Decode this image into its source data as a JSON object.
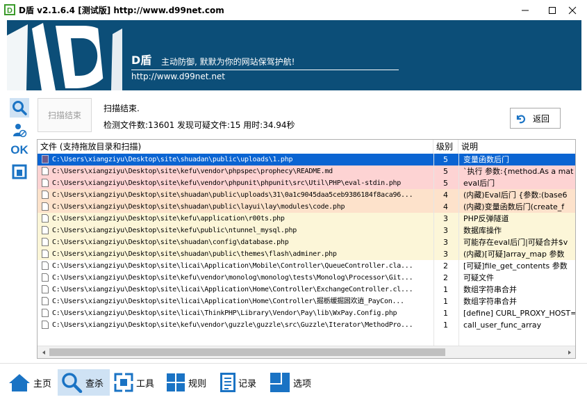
{
  "window": {
    "title": "D盾 v2.1.6.4 [测试版] http://www.d99net.com",
    "icon": "d-shield-app-icon",
    "controls": [
      "minimize",
      "maximize",
      "close"
    ]
  },
  "banner": {
    "logo_letter": "D",
    "brand": "D盾",
    "slogan": "主动防御, 默默为你的网站保驾护航!",
    "url": "http://www.d99net.net"
  },
  "sidebar_icons": [
    "search-icon",
    "user-shield-icon",
    "ok-icon",
    "window-icon"
  ],
  "sidebar_ok_text": "OK",
  "scan": {
    "button_label": "扫描结束",
    "status": "扫描结束.",
    "summary": "检测文件数:13601 发现可疑文件:15 用时:34.94秒",
    "back_label": "返回"
  },
  "table": {
    "headers": {
      "file": "文件 (支持拖放目录和扫描)",
      "level": "级别",
      "desc": "说明"
    },
    "rows": [
      {
        "file": "C:\\Users\\xiangziyu\\Desktop\\site\\shuadan\\public\\uploads\\1.php",
        "level": "5",
        "desc": "变量函数后门",
        "style": "selected"
      },
      {
        "file": "C:\\Users\\xiangziyu\\Desktop\\site\\kefu\\vendor\\phpspec\\prophecy\\README.md",
        "level": "5",
        "desc": "`执行 参数:{method.As a mat",
        "style": "red"
      },
      {
        "file": "C:\\Users\\xiangziyu\\Desktop\\site\\kefu\\vendor\\phpunit\\phpunit\\src\\Util\\PHP\\eval-stdin.php",
        "level": "5",
        "desc": "eval后门",
        "style": "red"
      },
      {
        "file": "C:\\Users\\xiangziyu\\Desktop\\site\\shuadan\\public\\uploads\\31\\0a1c9045daa5ceb9386184f8aca96...",
        "level": "4",
        "desc": "(内藏)Eval后门 {参数:(base6",
        "style": "orange"
      },
      {
        "file": "C:\\Users\\xiangziyu\\Desktop\\site\\shuadan\\public\\layui\\lay\\modules\\code.php",
        "level": "4",
        "desc": "(内藏)变量函数后门(create_f",
        "style": "orange"
      },
      {
        "file": "C:\\Users\\xiangziyu\\Desktop\\site\\kefu\\application\\r00ts.php",
        "level": "3",
        "desc": "PHP反弹隧道",
        "style": "yellow"
      },
      {
        "file": "C:\\Users\\xiangziyu\\Desktop\\site\\kefu\\public\\ntunnel_mysql.php",
        "level": "3",
        "desc": "数据库操作",
        "style": "yellow"
      },
      {
        "file": "C:\\Users\\xiangziyu\\Desktop\\site\\shuadan\\config\\database.php",
        "level": "3",
        "desc": "可能存在eval后门|可疑合并$v",
        "style": "yellow"
      },
      {
        "file": "C:\\Users\\xiangziyu\\Desktop\\site\\shuadan\\public\\themes\\flash\\adminer.php",
        "level": "3",
        "desc": "(内藏)[可疑]array_map 参数",
        "style": "yellow"
      },
      {
        "file": "C:\\Users\\xiangziyu\\Desktop\\site\\licai\\Application\\Mobile\\Controller\\QueueController.cla...",
        "level": "2",
        "desc": "[可疑]file_get_contents 参数",
        "style": "white"
      },
      {
        "file": "C:\\Users\\xiangziyu\\Desktop\\site\\kefu\\vendor\\monolog\\monolog\\tests\\Monolog\\Processor\\Git...",
        "level": "2",
        "desc": "可疑文件",
        "style": "white"
      },
      {
        "file": "C:\\Users\\xiangziyu\\Desktop\\site\\licai\\Application\\Home\\Controller\\ExchangeController.cl...",
        "level": "1",
        "desc": "数组字符串合并",
        "style": "white"
      },
      {
        "file": "C:\\Users\\xiangziyu\\Desktop\\site\\licai\\Application\\Home\\Controller\\掘栃缓掘囦欢逍_PayCon...",
        "level": "1",
        "desc": "数组字符串合并",
        "style": "white"
      },
      {
        "file": "C:\\Users\\xiangziyu\\Desktop\\site\\licai\\ThinkPHP\\Library\\Vendor\\Pay\\lib\\WxPay.Config.php",
        "level": "1",
        "desc": "[define] CURL_PROXY_HOST=>$",
        "style": "white"
      },
      {
        "file": "C:\\Users\\xiangziyu\\Desktop\\site\\kefu\\vendor\\guzzle\\guzzle\\src\\Guzzle\\Iterator\\MethodPro...",
        "level": "1",
        "desc": "call_user_func_array",
        "style": "white"
      }
    ]
  },
  "row_colors": {
    "selected": "#0a64d2",
    "red": "#fdd3d3",
    "orange": "#fde2cb",
    "yellow": "#fcf6d8",
    "white": "#ffffff"
  },
  "nav": {
    "items": [
      {
        "label": "主页",
        "icon": "home-icon"
      },
      {
        "label": "查杀",
        "icon": "search-icon",
        "active": true
      },
      {
        "label": "工具",
        "icon": "tools-icon"
      },
      {
        "label": "规则",
        "icon": "grid-icon"
      },
      {
        "label": "记录",
        "icon": "log-icon"
      },
      {
        "label": "选项",
        "icon": "options-icon"
      }
    ]
  },
  "colors": {
    "banner": "#0c4e78",
    "accent": "#1a73c4",
    "active_bg": "#cfe2f4"
  }
}
